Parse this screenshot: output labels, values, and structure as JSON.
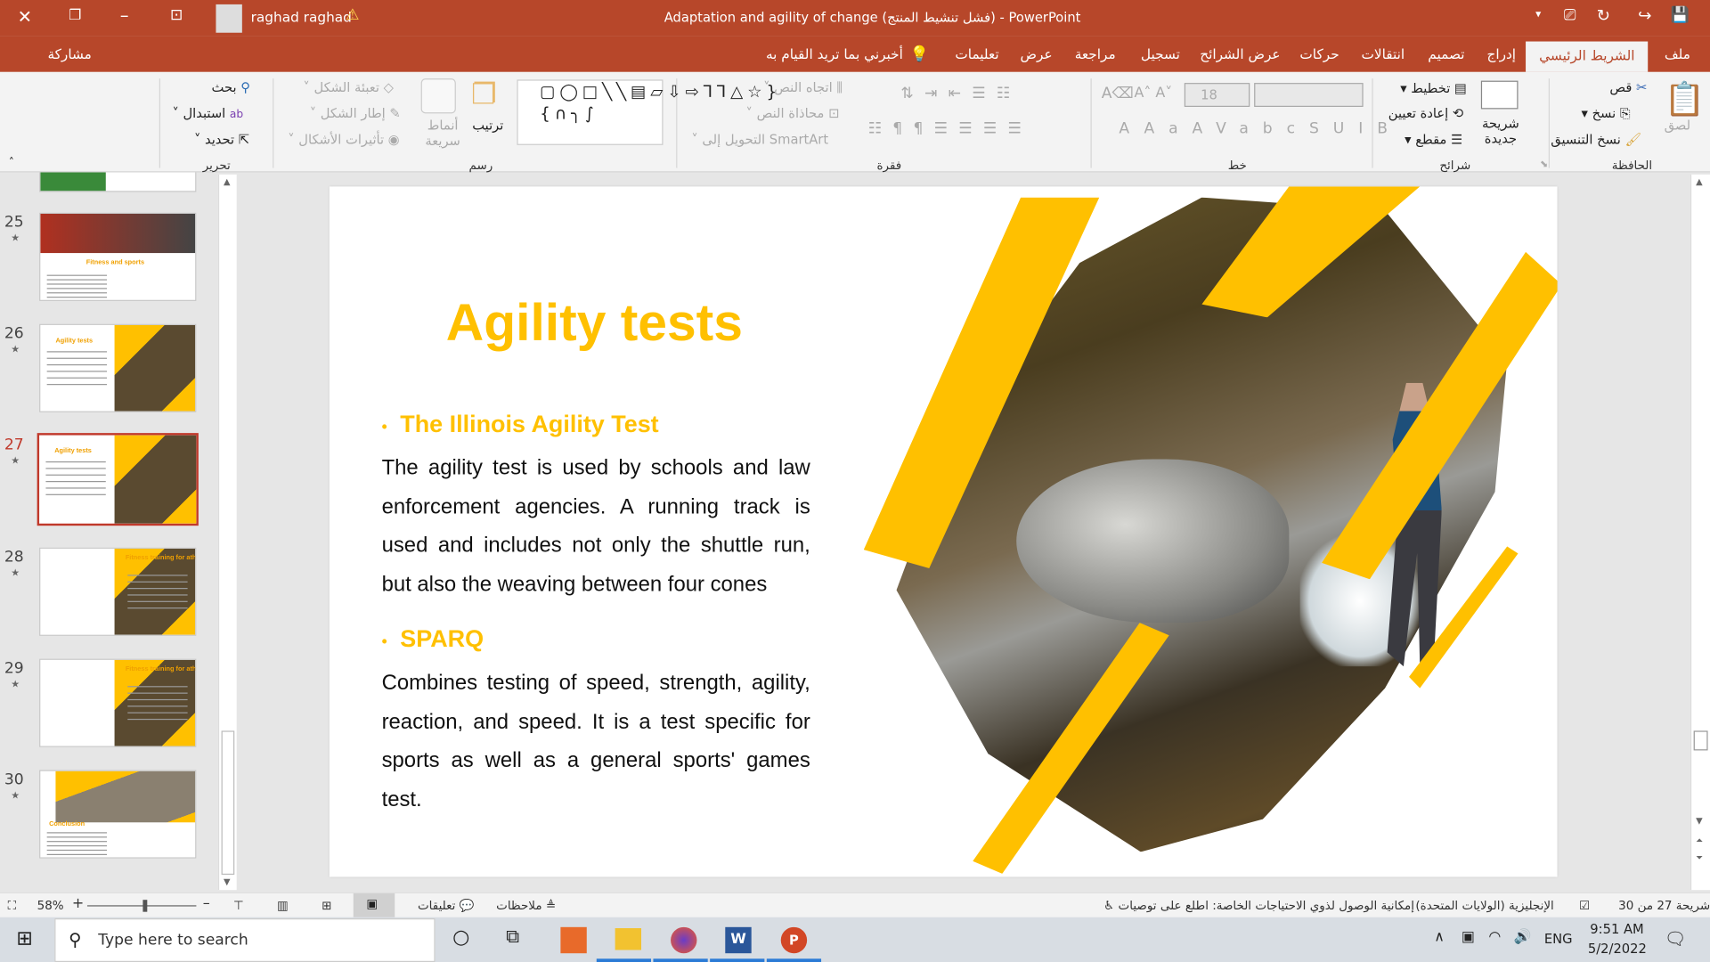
{
  "titlebar": {
    "title": "Adaptation and agility of change (فشل تنشيط المنتج)  -  PowerPoint",
    "user": "raghad raghad",
    "accent": "#b7472a"
  },
  "tabs": [
    {
      "label": "ملف"
    },
    {
      "label": "الشريط الرئيسي",
      "active": true
    },
    {
      "label": "إدراج"
    },
    {
      "label": "تصميم"
    },
    {
      "label": "انتقالات"
    },
    {
      "label": "حركات"
    },
    {
      "label": "عرض الشرائح"
    },
    {
      "label": "تسجيل"
    },
    {
      "label": "مراجعة"
    },
    {
      "label": "عرض"
    },
    {
      "label": "تعليمات"
    }
  ],
  "tellme": "أخبرني بما تريد القيام به",
  "share": "مشاركة",
  "ribbon": {
    "clipboard": {
      "label": "الحافظة",
      "paste": "لصق",
      "cut": "قص",
      "copy": "نسخ",
      "format_painter": "نسخ التنسيق"
    },
    "slides": {
      "label": "شرائح",
      "new_slide": "شريحة جديدة",
      "layout": "تخطيط",
      "reset": "إعادة تعيين",
      "section": "مقطع"
    },
    "font": {
      "label": "خط",
      "size": "18",
      "font_name": ""
    },
    "paragraph": {
      "label": "فقرة",
      "text_direction": "اتجاه النص",
      "align_text": "محاذاة النص",
      "smartart": "التحويل إلى SmartArt"
    },
    "drawing": {
      "label": "رسم",
      "arrange": "ترتيب",
      "quick_styles": "أنماط سريعة",
      "shape_fill": "تعبئة الشكل",
      "shape_outline": "إطار الشكل",
      "shape_effects": "تأثيرات الأشكال"
    },
    "editing": {
      "label": "تحرير",
      "find": "بحث",
      "replace": "استبدال",
      "select": "تحديد"
    }
  },
  "thumbnails": [
    {
      "num": "25",
      "title": "Fitness and sports"
    },
    {
      "num": "26",
      "title": "Agility tests"
    },
    {
      "num": "27",
      "title": "Agility tests",
      "selected": true
    },
    {
      "num": "28",
      "title": "Fitness training for athletes"
    },
    {
      "num": "29",
      "title": "Fitness training for athletes"
    },
    {
      "num": "30",
      "title": "Conclusion"
    }
  ],
  "slide": {
    "title": "Agility tests",
    "accent": "#ffc000",
    "bullet1": "The Illinois Agility Test",
    "para1": "The agility test is used by schools and law enforcement agencies. A running track is used and includes not only the shuttle run, but also the weaving between four cones",
    "bullet2": "SPARQ",
    "para2": "Combines testing of speed, strength, agility, reaction, and speed. It is a  test specific for sports as well as a general sports' games test."
  },
  "statusbar": {
    "slide_of": "شريحة 27 من 30",
    "language": "الإنجليزية (الولايات المتحدة)",
    "accessibility": "إمكانية الوصول لذوي الاحتياجات الخاصة: اطلع على توصيات",
    "notes": "ملاحظات",
    "comments": "تعليقات",
    "zoom": "58%",
    "zoom_percent": 58
  },
  "taskbar": {
    "search_placeholder": "Type here to search",
    "lang": "ENG",
    "time": "9:51 AM",
    "date": "5/2/2022"
  }
}
